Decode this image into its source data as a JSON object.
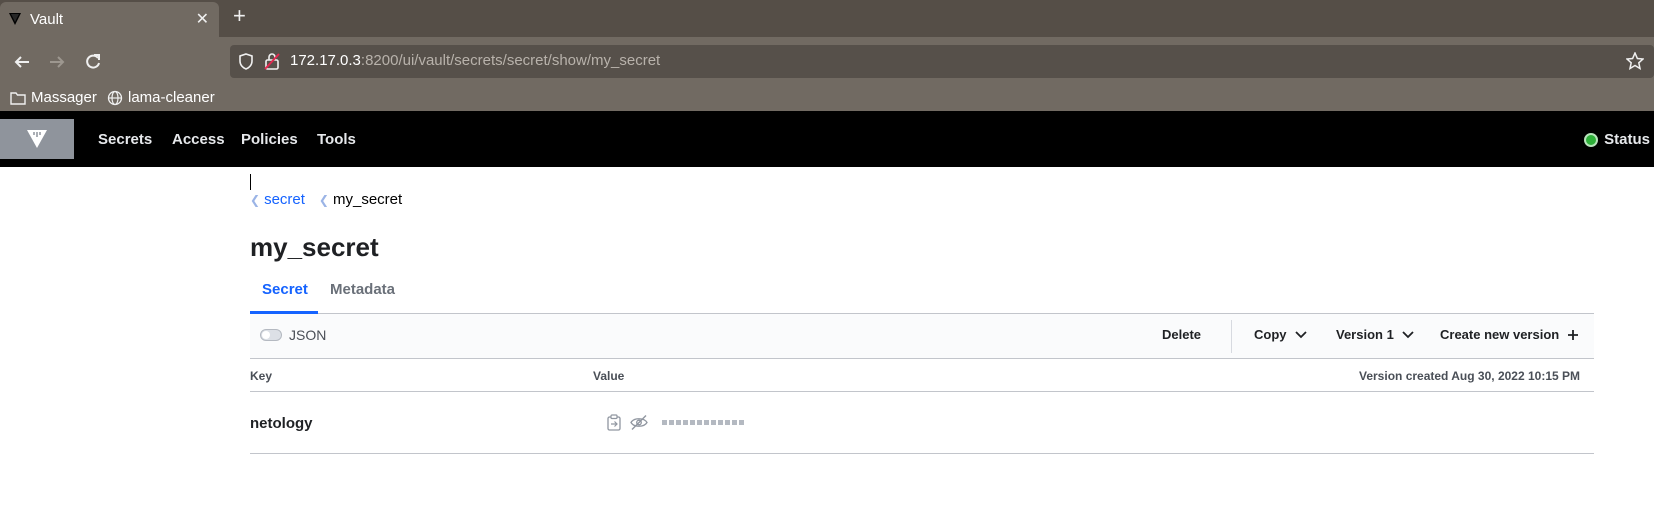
{
  "browser": {
    "tab_title": "Vault",
    "url_host": "172.17.0.3",
    "url_rest": ":8200/ui/vault/secrets/secret/show/my_secret",
    "bookmarks": [
      "Massager",
      "lama-cleaner"
    ]
  },
  "vault_nav": {
    "links": [
      "Secrets",
      "Access",
      "Policies",
      "Tools"
    ],
    "status_label": "Status",
    "status_color": "#2eb039"
  },
  "breadcrumb": {
    "parent": "secret",
    "current": "my_secret"
  },
  "page": {
    "title": "my_secret",
    "tabs": [
      "Secret",
      "Metadata"
    ],
    "active_tab": "Secret"
  },
  "toolbar": {
    "json_label": "JSON",
    "json_enabled": false,
    "delete_label": "Delete",
    "copy_label": "Copy",
    "version_label": "Version 1",
    "create_label": "Create new version"
  },
  "table": {
    "key_header": "Key",
    "value_header": "Value",
    "version_created": "Version created Aug 30, 2022 10:15 PM",
    "rows": [
      {
        "key": "netology",
        "masked_value": "▪▪▪▪▪▪▪▪▪▪▪▪"
      }
    ]
  },
  "colors": {
    "accent": "#1563ff",
    "nav_bg": "#000000",
    "browser_bg": "#716a62"
  }
}
